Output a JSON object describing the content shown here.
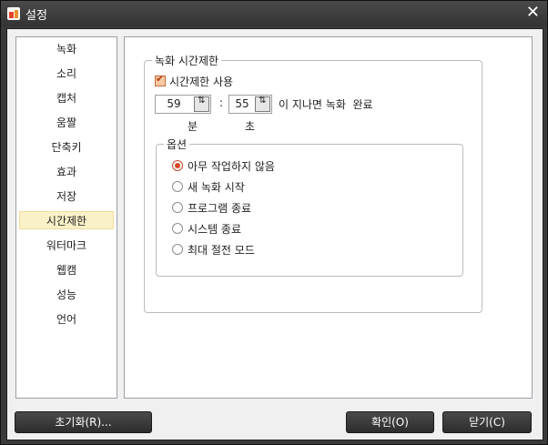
{
  "window": {
    "title": "설정",
    "close_glyph": "✕"
  },
  "sidebar": {
    "items": [
      {
        "label": "녹화"
      },
      {
        "label": "소리"
      },
      {
        "label": "캡처"
      },
      {
        "label": "움짤"
      },
      {
        "label": "단축키"
      },
      {
        "label": "효과"
      },
      {
        "label": "저장"
      },
      {
        "label": "시간제한"
      },
      {
        "label": "워터마크"
      },
      {
        "label": "웹캠"
      },
      {
        "label": "성능"
      },
      {
        "label": "언어"
      }
    ],
    "selected": "시간제한"
  },
  "time_limit": {
    "group_title": "녹화 시간제한",
    "enable_label": "시간제한 사용",
    "enable_checked": true,
    "minutes_value": "59",
    "seconds_value": "55",
    "separator": ":",
    "after_text": "이 지나면 녹화  완료",
    "minutes_unit": "분",
    "seconds_unit": "초",
    "options_title": "옵션",
    "options": [
      {
        "label": "아무 작업하지 않음",
        "checked": true
      },
      {
        "label": "새 녹화 시작",
        "checked": false
      },
      {
        "label": "프로그램 종료",
        "checked": false
      },
      {
        "label": "시스템 종료",
        "checked": false
      },
      {
        "label": "최대 절전 모드",
        "checked": false
      }
    ]
  },
  "buttons": {
    "reset": "초기화(R)...",
    "ok": "확인(O)",
    "close": "닫기(C)"
  },
  "icons": {
    "spin_arrows": "⇅"
  },
  "colors": {
    "accent": "#d24a24",
    "selected_bg": "#fbf1c9"
  }
}
